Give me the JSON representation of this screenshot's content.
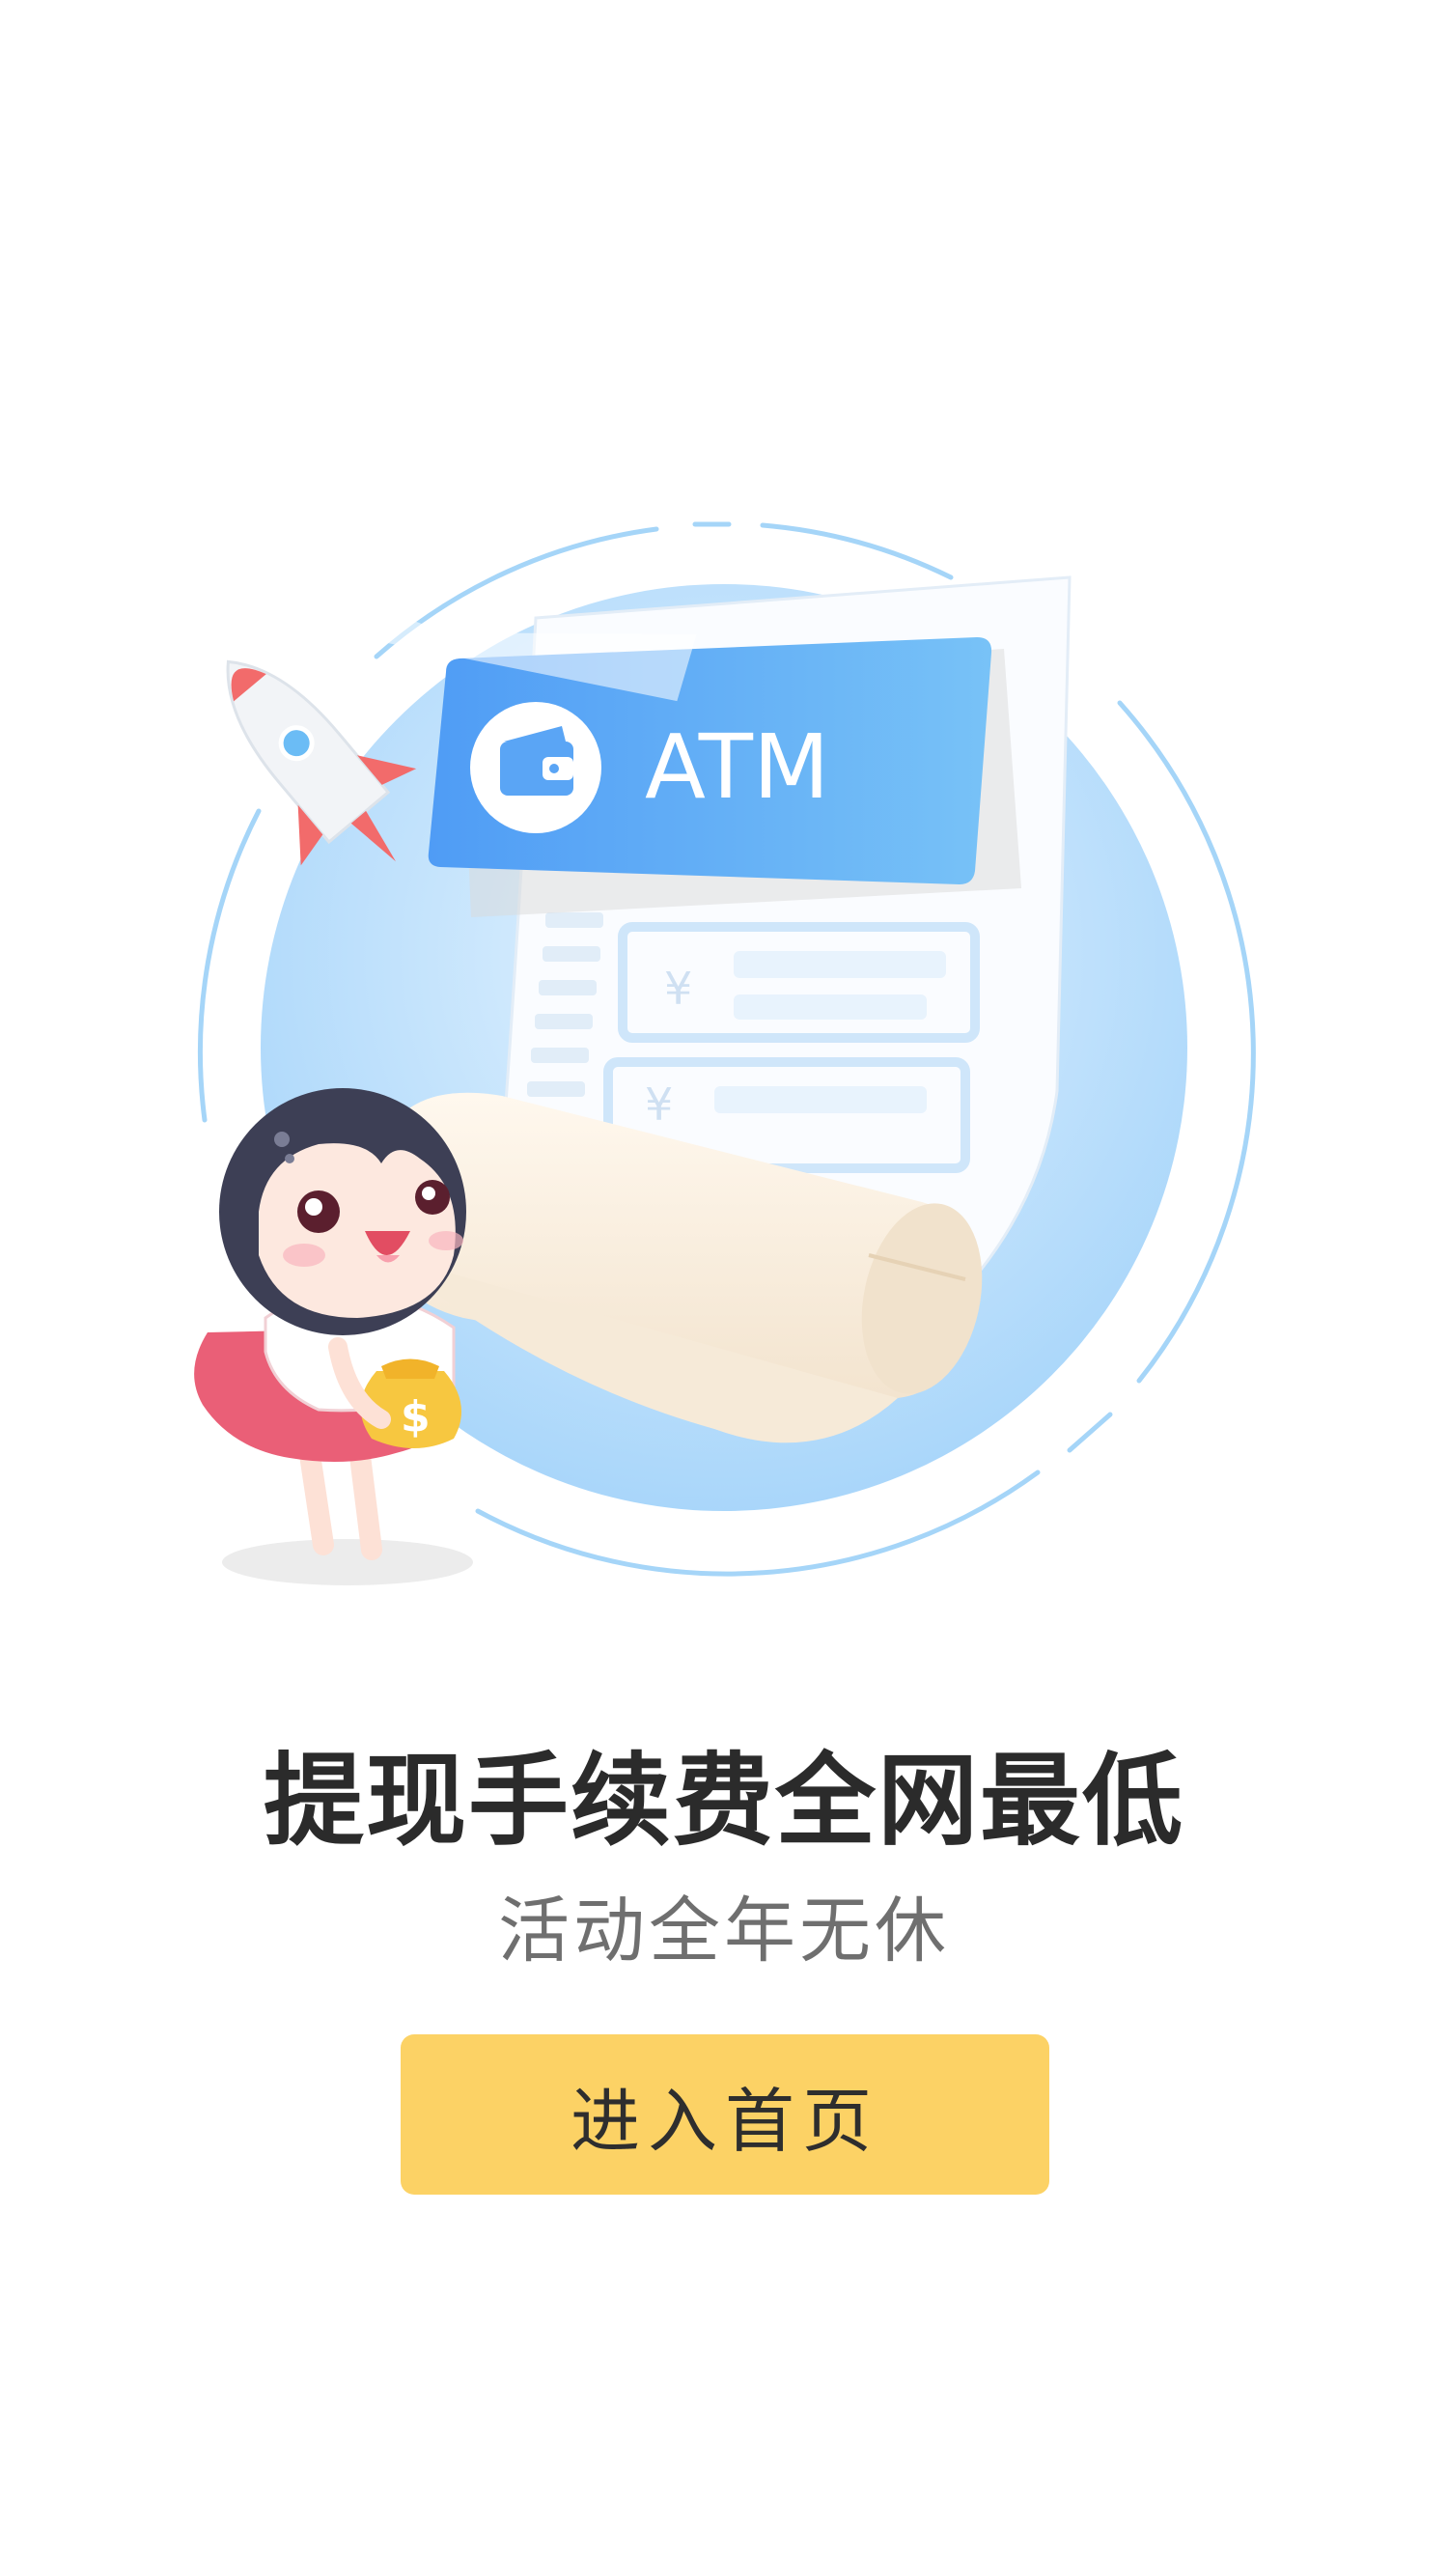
{
  "illustration": {
    "atm_label": "ATM",
    "currency_symbol": "¥",
    "bag_symbol": "$"
  },
  "headline": "提现手续费全网最低",
  "subline": "活动全年无休",
  "enter_button": {
    "label": "进入首页"
  },
  "colors": {
    "button": "#fcd265",
    "headline": "#2b2b2b",
    "subline": "#6f6f6f",
    "circle": "#a9d9fb",
    "atm_card": "#5ea8f6"
  },
  "icons": [
    "rocket-icon",
    "wallet-icon",
    "money-bag-icon"
  ]
}
